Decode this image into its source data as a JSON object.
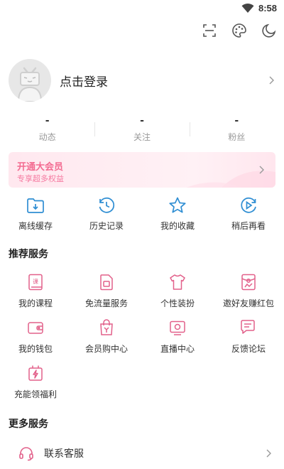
{
  "status_bar": {
    "time": "8:58",
    "wifi_icon": "wifi-icon"
  },
  "top_actions": [
    "scan-icon",
    "palette-icon",
    "night-mode-icon"
  ],
  "profile": {
    "login_text": "点击登录"
  },
  "stats": [
    {
      "value": "-",
      "label": "动态"
    },
    {
      "value": "-",
      "label": "关注"
    },
    {
      "value": "-",
      "label": "粉丝"
    }
  ],
  "vip": {
    "title": "开通大会员",
    "subtitle": "专享超多权益"
  },
  "quick_actions": [
    {
      "label": "离线缓存",
      "icon": "download-folder-icon"
    },
    {
      "label": "历史记录",
      "icon": "history-clock-icon"
    },
    {
      "label": "我的收藏",
      "icon": "star-icon"
    },
    {
      "label": "稍后再看",
      "icon": "watch-later-icon"
    }
  ],
  "recommended": {
    "title": "推荐服务",
    "items": [
      {
        "label": "我的课程",
        "icon": "course-book-icon"
      },
      {
        "label": "免流量服务",
        "icon": "sim-card-icon"
      },
      {
        "label": "个性装扮",
        "icon": "tshirt-icon"
      },
      {
        "label": "邀好友赚红包",
        "icon": "red-envelope-icon"
      },
      {
        "label": "我的钱包",
        "icon": "wallet-icon"
      },
      {
        "label": "会员购中心",
        "icon": "shopping-bag-icon"
      },
      {
        "label": "直播中心",
        "icon": "live-tv-icon"
      },
      {
        "label": "反馈论坛",
        "icon": "feedback-chat-icon"
      },
      {
        "label": "充能领福利",
        "icon": "charge-gift-icon"
      }
    ]
  },
  "more": {
    "title": "更多服务",
    "items": [
      {
        "label": "联系客服",
        "icon": "headset-icon"
      }
    ]
  },
  "colors": {
    "accent": "#fb7299",
    "vip_text": "#f36b91",
    "blue_icon": "#2f8ed3"
  }
}
